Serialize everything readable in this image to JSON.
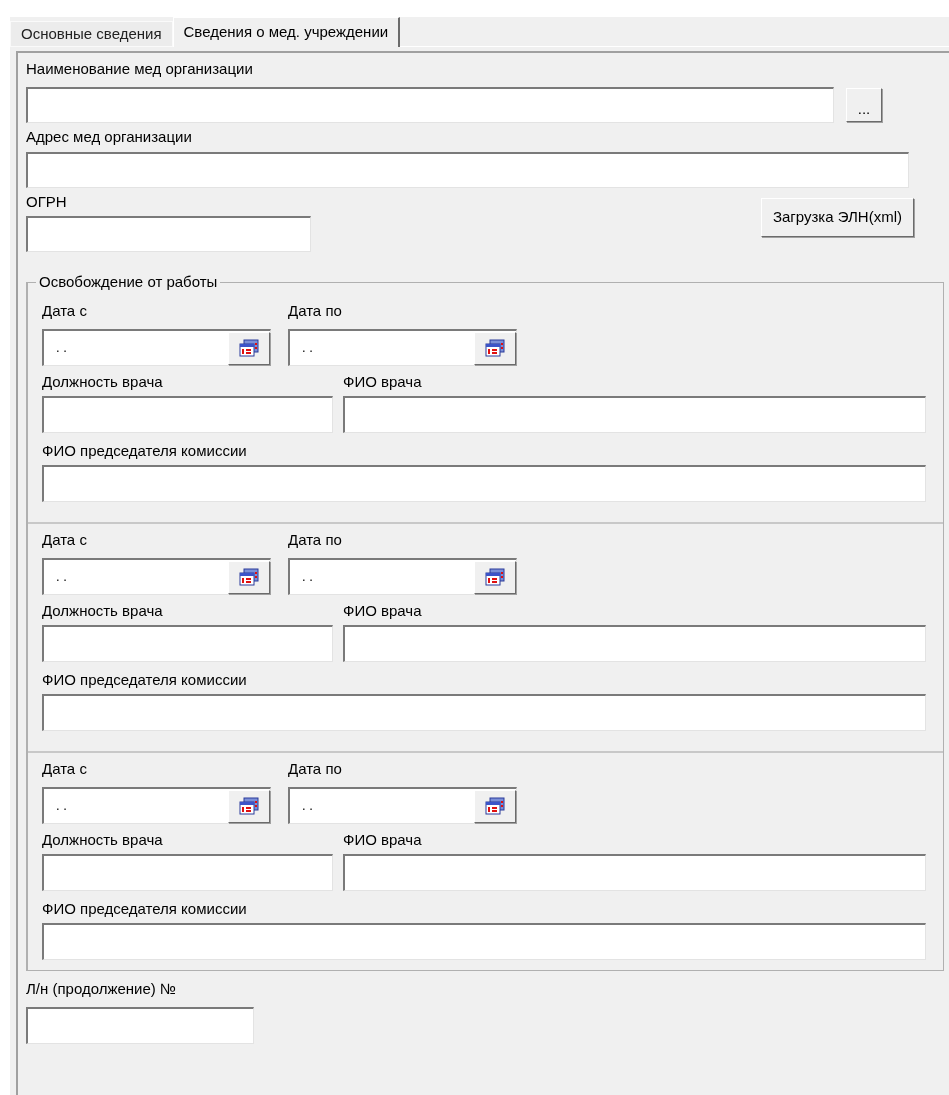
{
  "tabs": [
    {
      "label": "Основные сведения",
      "selected": false
    },
    {
      "label": "Сведения о мед. учреждении",
      "selected": true
    }
  ],
  "org_name": {
    "label": "Наименование мед организации",
    "button": "..."
  },
  "org_address": {
    "label": "Адрес мед организации"
  },
  "ogrn": {
    "label": "ОГРН"
  },
  "load_button": "Загрузка ЭЛН(xml)",
  "release": {
    "title": "Освобождение от работы",
    "periods": [
      {
        "date_from": {
          "label": "Дата с",
          "value": ". ."
        },
        "date_to": {
          "label": "Дата по",
          "value": ". ."
        },
        "position": {
          "label": "Должность врача"
        },
        "doctor": {
          "label": "ФИО врача"
        },
        "chairman": {
          "label": "ФИО председателя комиссии"
        }
      },
      {
        "date_from": {
          "label": "Дата с",
          "value": ". ."
        },
        "date_to": {
          "label": "Дата по",
          "value": ". ."
        },
        "position": {
          "label": "Должность врача"
        },
        "doctor": {
          "label": "ФИО врача"
        },
        "chairman": {
          "label": "ФИО председателя комиссии"
        }
      },
      {
        "date_from": {
          "label": "Дата с",
          "value": ". ."
        },
        "date_to": {
          "label": "Дата по",
          "value": ". ."
        },
        "position": {
          "label": "Должность врача"
        },
        "doctor": {
          "label": "ФИО врача"
        },
        "chairman": {
          "label": "ФИО председателя комиссии"
        }
      }
    ]
  },
  "continuation": {
    "label": "Л/н (продолжение) №"
  }
}
